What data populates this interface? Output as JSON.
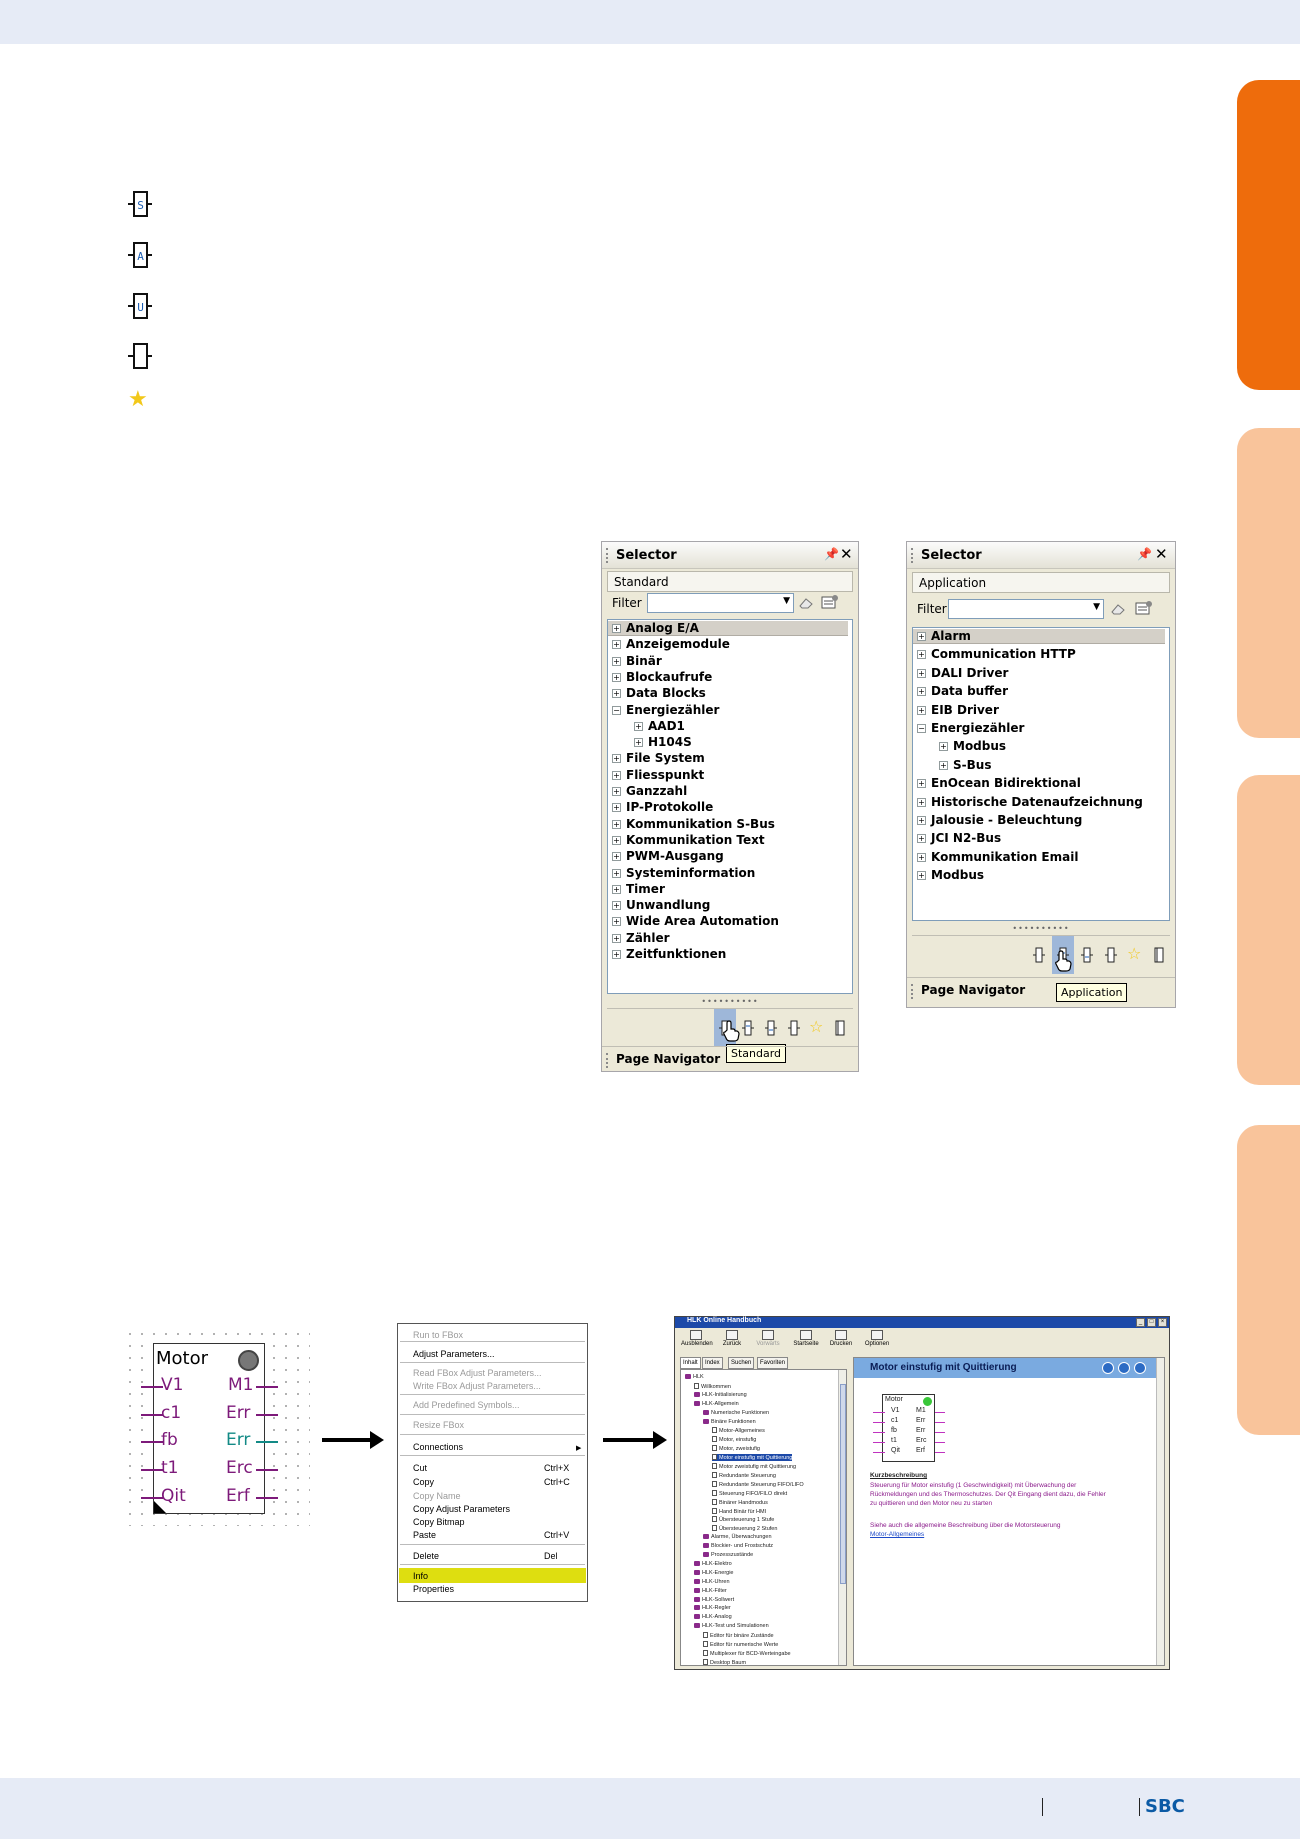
{
  "footer": {
    "logo": "SBC"
  },
  "selector_standard": {
    "title": "Selector",
    "mode": "Standard",
    "filter_label": "Filter",
    "items": [
      "Analog E/A",
      "Anzeigemodule",
      "Binär",
      "Blockaufrufe",
      "Data Blocks",
      "Energiezähler",
      "AAD1",
      "H104S",
      "File System",
      "Fliesspunkt",
      "Ganzzahl",
      "IP-Protokolle",
      "Kommunikation S-Bus",
      "Kommunikation Text",
      "PWM-Ausgang",
      "Systeminformation",
      "Timer",
      "Unwandlung",
      "Wide Area Automation",
      "Zähler",
      "Zeitfunktionen"
    ],
    "tooltip": "Standard",
    "page_navigator": "Page Navigator"
  },
  "selector_application": {
    "title": "Selector",
    "mode": "Application",
    "filter_label": "Filter",
    "items": [
      "Alarm",
      "Communication HTTP",
      "DALI Driver",
      "Data buffer",
      "EIB Driver",
      "Energiezähler",
      "Modbus",
      "S-Bus",
      "EnOcean Bidirektional",
      "Historische Datenaufzeichnung",
      "Jalousie - Beleuchtung",
      "JCI N2-Bus",
      "Kommunikation Email",
      "Modbus"
    ],
    "tooltip": "Application",
    "page_navigator": "Page Navigator"
  },
  "motor_fbox": {
    "title": "Motor",
    "inputs": [
      "V1",
      "c1",
      "fb",
      "t1",
      "Qit"
    ],
    "outputs": [
      "M1",
      "Err",
      "Err",
      "Erc",
      "Erf"
    ]
  },
  "context_menu": {
    "items": [
      "Run to FBox",
      "Adjust Parameters...",
      "Read FBox Adjust Parameters...",
      "Write FBox Adjust Parameters...",
      "Add Predefined Symbols...",
      "Resize FBox",
      "Connections",
      "Cut",
      "Copy",
      "Copy Name",
      "Copy Adjust Parameters",
      "Copy Bitmap",
      "Paste",
      "Delete",
      "Info",
      "Properties"
    ],
    "shortcuts": {
      "cut": "Ctrl+X",
      "copy": "Ctrl+C",
      "paste": "Ctrl+V",
      "delete": "Del"
    }
  },
  "help_window": {
    "title": "HLK Online Handbuch",
    "toolbar": [
      "Ausblenden",
      "Zurück",
      "Vorwärts",
      "Startseite",
      "Drucken",
      "Optionen"
    ],
    "tabs": [
      "Inhalt",
      "Index",
      "Suchen",
      "Favoriten"
    ],
    "tree": [
      "HLK",
      "Willkommen",
      "HLK-Initialisierung",
      "HLK-Allgemein",
      "Numerische Funktionen",
      "Binäre Funktionen",
      "Motor-Allgemeines",
      "Motor, einstufig",
      "Motor, zweistufig",
      "Motor einstufig mit Quittierung",
      "Motor zweistufig mit Quittierung",
      "Redundante Steuerung",
      "Redundante Steuerung FIFO/LIFO",
      "Steuerung FIFO/FILO direkt",
      "Binärer Handmodus",
      "Hand Binär für HMI",
      "Übersteuerung 1 Stufe",
      "Übersteuerung 2 Stufen",
      "Alarme, Überwachungen",
      "Blockier- und Frostschutz",
      "Prozesszustände",
      "HLK-Elektro",
      "HLK-Energie",
      "HLK-Uhren",
      "HLK-Filter",
      "HLK-Sollwert",
      "HLK-Regler",
      "HLK-Analog",
      "HLK-Test und Simulationen",
      "Editor für binäre Zustände",
      "Editor für numerische Werte",
      "Multiplexer für BCD-Werteingabe",
      "Desktop Baum"
    ],
    "heading": "Motor einstufig mit Quittierung",
    "mini_fbox": {
      "title": "Motor",
      "inputs": [
        "V1",
        "c1",
        "fb",
        "t1",
        "Qit"
      ],
      "outputs": [
        "M1",
        "Err",
        "Err",
        "Erc",
        "Erf"
      ]
    },
    "kurz_title": "Kurzbeschreibung",
    "kurz_lines": [
      "Steuerung für Motor einstufig (1 Geschwindigkeit) mit Überwachung der",
      "Rückmeldungen und des Thermoschutzes. Der Qit Eingang dient dazu, die Fehler",
      "zu quittieren und den Motor neu zu starten"
    ],
    "see_also": "Siehe auch die allgemeine Beschreibung über die Motorsteuerung",
    "link": "Motor-Allgemeines"
  }
}
